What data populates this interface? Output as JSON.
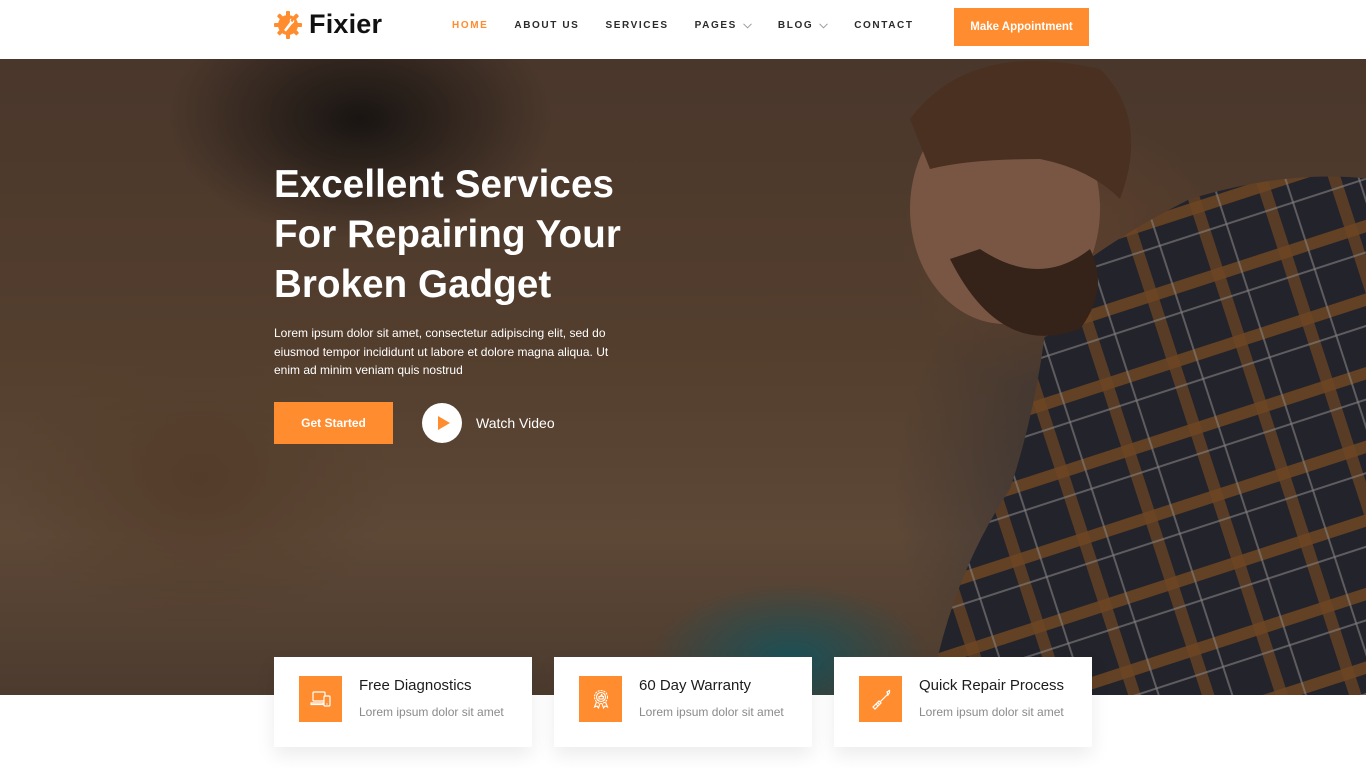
{
  "brand": {
    "name": "Fixier",
    "logo_icon": "gear-wrench-icon",
    "accent_color": "#ff8c2e"
  },
  "nav": {
    "items": [
      {
        "label": "HOME",
        "active": true,
        "has_dropdown": false
      },
      {
        "label": "ABOUT US",
        "active": false,
        "has_dropdown": false
      },
      {
        "label": "SERVICES",
        "active": false,
        "has_dropdown": false
      },
      {
        "label": "PAGES",
        "active": false,
        "has_dropdown": true
      },
      {
        "label": "BLOG",
        "active": false,
        "has_dropdown": true
      },
      {
        "label": "CONTACT",
        "active": false,
        "has_dropdown": false
      }
    ],
    "cta_label": "Make Appointment"
  },
  "hero": {
    "title_lines": [
      "Excellent Services",
      "For Repairing Your",
      "Broken Gadget"
    ],
    "description": "Lorem ipsum dolor sit amet, consectetur adipiscing elit, sed do eiusmod tempor incididunt ut labore et dolore magna aliqua. Ut enim ad minim veniam quis nostrud",
    "primary_button": "Get Started",
    "video_label": "Watch Video",
    "video_icon": "play-icon"
  },
  "features": [
    {
      "title": "Free Diagnostics",
      "description": "Lorem ipsum dolor sit amet",
      "icon": "devices-icon"
    },
    {
      "title": "60 Day Warranty",
      "description": "Lorem ipsum dolor sit amet",
      "icon": "award-badge-icon"
    },
    {
      "title": "Quick Repair Process",
      "description": "Lorem ipsum dolor sit amet",
      "icon": "screwdriver-icon"
    }
  ]
}
